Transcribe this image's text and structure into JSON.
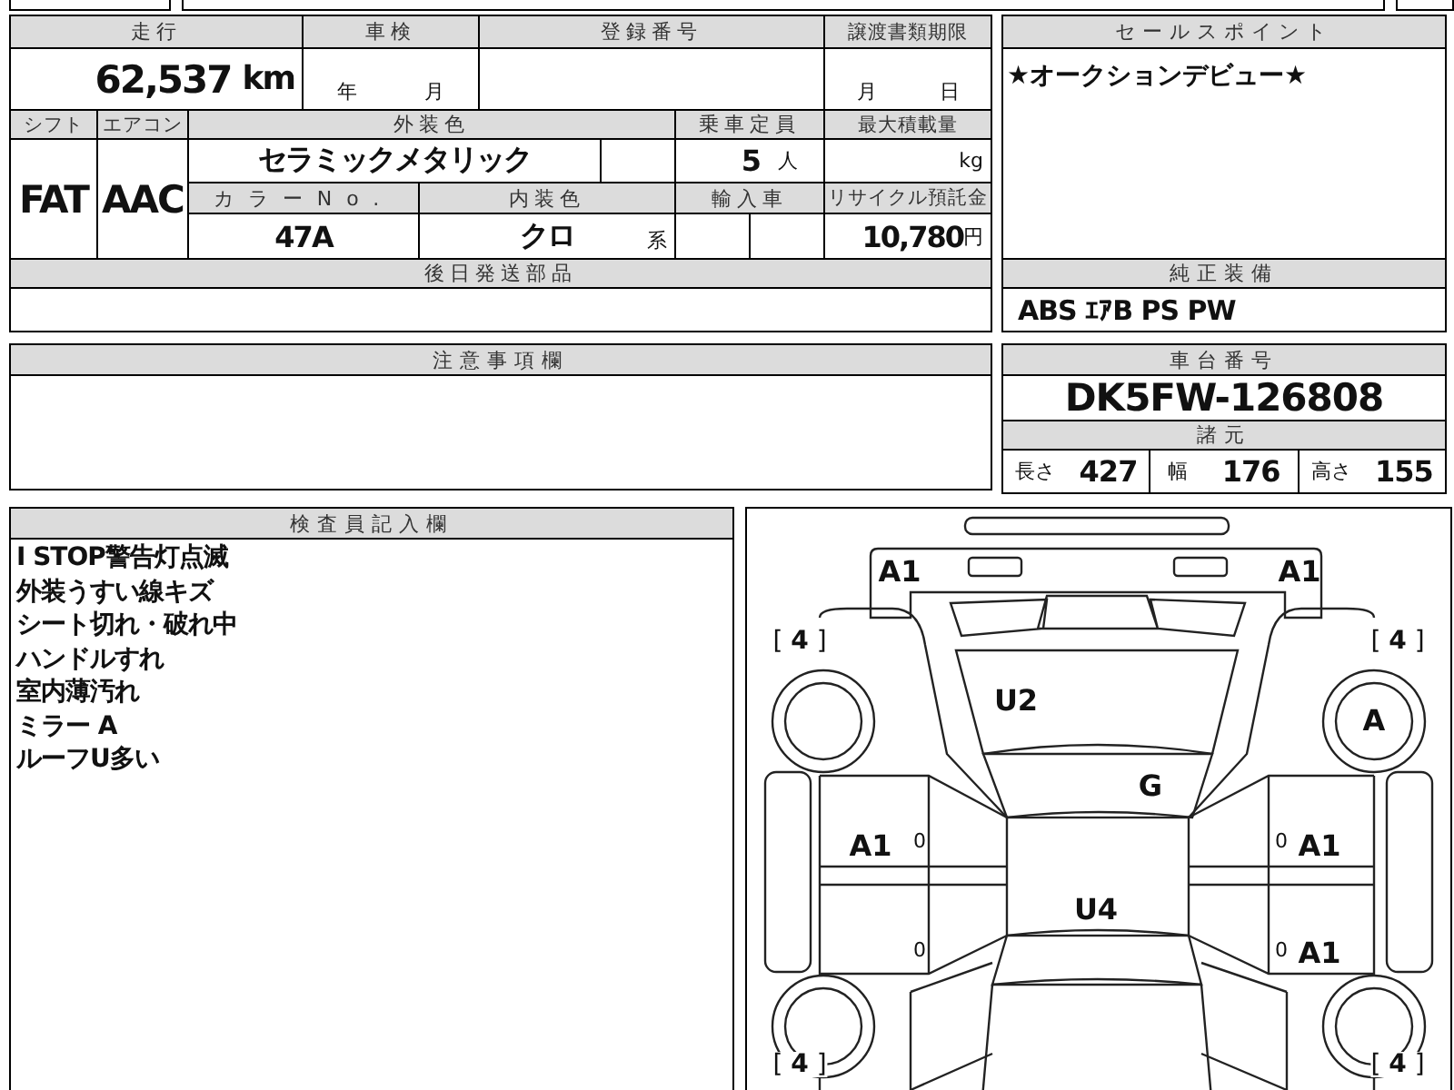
{
  "mileage": {
    "label": "走行",
    "value": "62,537",
    "unit": "km"
  },
  "inspection": {
    "label": "車検",
    "year_unit": "年",
    "month_unit": "月"
  },
  "registration": {
    "label": "登録番号"
  },
  "transfer_deadline": {
    "label": "譲渡書類期限",
    "month_unit": "月",
    "day_unit": "日"
  },
  "shift": {
    "label": "シフト",
    "value": "FAT"
  },
  "aircon": {
    "label": "エアコン",
    "value": "AAC"
  },
  "exterior_color": {
    "label": "外装色",
    "value": "セラミックメタリック"
  },
  "capacity": {
    "label": "乗車定員",
    "value": "5",
    "unit": "人"
  },
  "max_load": {
    "label": "最大積載量",
    "unit": "kg"
  },
  "color_no": {
    "label": "カラーNo.",
    "value": "47A"
  },
  "interior_color": {
    "label": "内装色",
    "value": "クロ",
    "suffix": "系"
  },
  "import_car": {
    "label": "輸入車"
  },
  "recycle_fee": {
    "label": "リサイクル預託金",
    "value": "10,780",
    "unit": "円"
  },
  "later_parts": {
    "label": "後日発送部品"
  },
  "sales_point": {
    "label": "セールスポイント",
    "text": "★オークションデビュー★"
  },
  "equipment": {
    "label": "純正装備",
    "text": "ABS ｴｱB PS PW"
  },
  "notes": {
    "label": "注意事項欄"
  },
  "chassis": {
    "label": "車台番号",
    "value": "DK5FW-126808"
  },
  "specs": {
    "label": "諸元",
    "items": [
      {
        "label": "長さ",
        "value": "427"
      },
      {
        "label": "幅",
        "value": "176"
      },
      {
        "label": "高さ",
        "value": "155"
      }
    ]
  },
  "inspector": {
    "label": "検査員記入欄",
    "lines": [
      "I STOP警告灯点滅",
      "外装うすい線キズ",
      "シート切れ・破れ中",
      "ハンドルすれ",
      "室内薄汚れ",
      "ミラー A",
      "ルーフU多い"
    ]
  },
  "diagram": {
    "marks": [
      {
        "kind": "front_bumper_left",
        "code": "A1"
      },
      {
        "kind": "front_bumper_right",
        "code": "A1"
      },
      {
        "kind": "hood",
        "code": "U2"
      },
      {
        "kind": "right_mirror",
        "code": "A"
      },
      {
        "kind": "windshield",
        "code": "G"
      },
      {
        "kind": "left_front_door",
        "code": "A1"
      },
      {
        "kind": "left_front_door_small",
        "code": "0"
      },
      {
        "kind": "right_front_door_small",
        "code": "0"
      },
      {
        "kind": "right_front_door",
        "code": "A1"
      },
      {
        "kind": "roof",
        "code": "U4"
      },
      {
        "kind": "left_rear_door_small",
        "code": "0"
      },
      {
        "kind": "right_rear_door_small",
        "code": "0"
      },
      {
        "kind": "right_rear_door",
        "code": "A1"
      }
    ],
    "tires": [
      {
        "kind": "front_left",
        "text": "[ **4** ]"
      },
      {
        "kind": "front_right",
        "text": "[ **4** ]"
      },
      {
        "kind": "rear_left",
        "text": "[ **4** ]"
      },
      {
        "kind": "rear_right",
        "text": "[ **4** ]"
      }
    ]
  }
}
